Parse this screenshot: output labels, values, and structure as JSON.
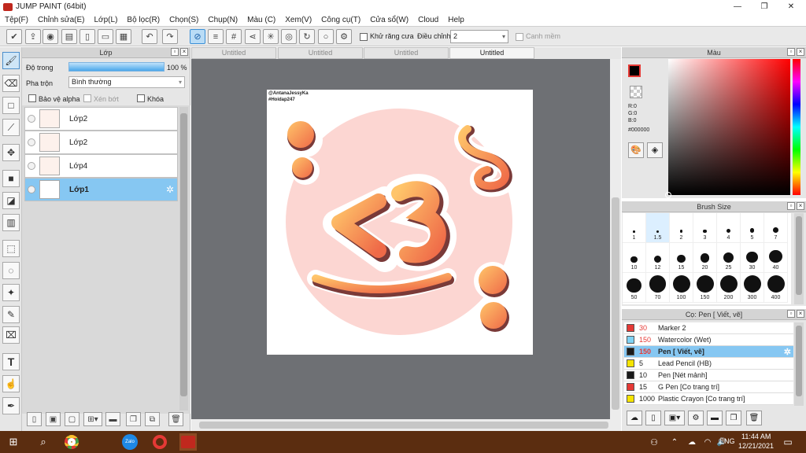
{
  "window": {
    "title": "JUMP PAINT (64bit)"
  },
  "menu": [
    "Tệp(F)",
    "Chỉnh sửa(E)",
    "Lớp(L)",
    "Bộ lọc(R)",
    "Chọn(S)",
    "Chụp(N)",
    "Màu (C)",
    "Xem(V)",
    "Công cụ(T)",
    "Cửa sổ(W)",
    "Cloud",
    "Help"
  ],
  "toolbar": {
    "antialias_label": "Khử răng cưa",
    "adjust_label": "Điều chỉnh",
    "adjust_value": "2",
    "smooth_label": "Canh mềm"
  },
  "layer_panel": {
    "title": "Lớp",
    "opacity_label": "Độ trong",
    "opacity_value": "100 %",
    "opacity_fraction": 1.0,
    "blend_label": "Pha trộn",
    "blend_value": "Bình thường",
    "protect_alpha": "Bảo vệ alpha",
    "clip": "Xén bớt",
    "lock": "Khóa",
    "layers": [
      {
        "name": "Lớp2"
      },
      {
        "name": "Lớp2"
      },
      {
        "name": "Lớp4"
      },
      {
        "name": "Lớp1"
      }
    ]
  },
  "tabs": [
    "Untitled",
    "Untitled",
    "Untitled",
    "Untitled"
  ],
  "canvas": {
    "watermark1": "@AntanaJessyKa",
    "watermark2": "#Hoidap247"
  },
  "color_panel": {
    "title": "Màu",
    "r": "R:0",
    "g": "G:0",
    "b": "B:0",
    "hex": "#000000",
    "accent": "#ff0000"
  },
  "brush_panel": {
    "title": "Brush Size",
    "sizes": [
      "1",
      "1.5",
      "2",
      "3",
      "4",
      "5",
      "7",
      "10",
      "12",
      "15",
      "20",
      "25",
      "30",
      "40",
      "50",
      "70",
      "100",
      "150",
      "200",
      "300",
      "400"
    ]
  },
  "pen_panel": {
    "title": "Cọ: Pen [ Viết, vẽ]",
    "items": [
      {
        "size": "30",
        "name": "Marker 2",
        "color": "#e53935"
      },
      {
        "size": "150",
        "name": "Watercolor (Wet)",
        "color": "#7fd3f5"
      },
      {
        "size": "150",
        "name": "Pen [ Viết, vẽ]",
        "color": "#1a1a1a"
      },
      {
        "size": "5",
        "name": "Lead Pencil (HB)",
        "color": "#f5e400"
      },
      {
        "size": "10",
        "name": "Pen [Nét mảnh]",
        "color": "#1a1a1a"
      },
      {
        "size": "15",
        "name": "G Pen [Co trang trí]",
        "color": "#e53935"
      },
      {
        "size": "1000",
        "name": "Plastic Crayon [Co trang trí]",
        "color": "#f5e400"
      }
    ]
  },
  "taskbar": {
    "lang": "ENG",
    "time": "11:44 AM",
    "date": "12/21/2021"
  }
}
